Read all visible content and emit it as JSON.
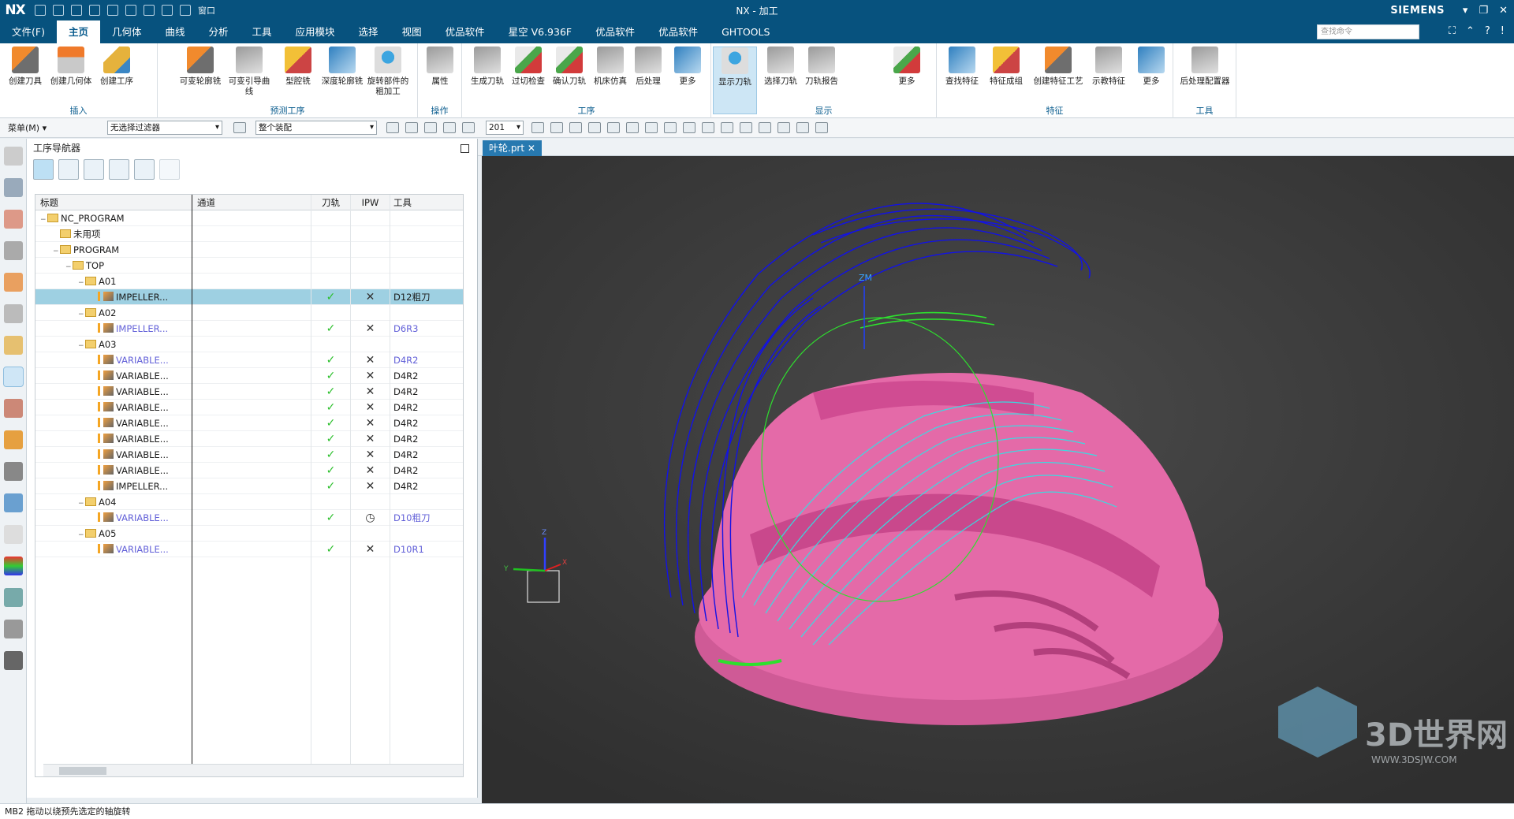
{
  "titlebar": {
    "logo": "NX",
    "window_label": "窗口",
    "title": "NX - 加工",
    "brand": "SIEMENS",
    "buttons": [
      "▾",
      "❐",
      "✕"
    ]
  },
  "menu": {
    "tabs": [
      "文件(F)",
      "主页",
      "几何体",
      "曲线",
      "分析",
      "工具",
      "应用模块",
      "选择",
      "视图",
      "优品软件",
      "星空 V6.936F",
      "优品软件",
      "优品软件",
      "GHTOOLS"
    ],
    "active": "主页",
    "search_placeholder": "查找命令"
  },
  "ribbon": {
    "groups": [
      {
        "label": "插入",
        "buttons": [
          "创建刀具",
          "创建几何体",
          "创建工序"
        ]
      },
      {
        "label": "预测工序",
        "buttons": [
          "可变轮廓铣",
          "可变引导曲线",
          "型腔铣",
          "深度轮廓铣",
          "旋转部件的粗加工"
        ]
      },
      {
        "label": "操作",
        "buttons": [
          "属性"
        ]
      },
      {
        "label": "工序",
        "buttons": [
          "生成刀轨",
          "过切检查",
          "确认刀轨",
          "机床仿真",
          "后处理",
          "更多"
        ]
      },
      {
        "label": "显示",
        "buttons": [
          "显示刀轨",
          "选择刀轨",
          "刀轨报告",
          "更多"
        ]
      },
      {
        "label": "特征",
        "buttons": [
          "查找特征",
          "特征成组",
          "创建特征工艺",
          "示教特征",
          "更多"
        ]
      },
      {
        "label": "工具",
        "buttons": [
          "后处理配置器"
        ]
      }
    ]
  },
  "toolbar2": {
    "menu_label": "菜单(M) ▾",
    "filter": "无选择过滤器",
    "scope": "整个装配",
    "layer": "201"
  },
  "navigator": {
    "title": "工序导航器",
    "columns": [
      "标题",
      "通道",
      "刀轨",
      "IPW",
      "工具"
    ],
    "rows": [
      {
        "indent": 0,
        "type": "root",
        "name": "NC_PROGRAM",
        "path": "",
        "ipw": "",
        "tool": ""
      },
      {
        "indent": 1,
        "type": "folder",
        "name": "未用项",
        "path": "",
        "ipw": "",
        "tool": ""
      },
      {
        "indent": 1,
        "type": "folder",
        "name": "PROGRAM",
        "path": "",
        "ipw": "",
        "tool": ""
      },
      {
        "indent": 2,
        "type": "folder",
        "name": "TOP",
        "path": "",
        "ipw": "",
        "tool": ""
      },
      {
        "indent": 3,
        "type": "folder",
        "name": "A01",
        "path": "",
        "ipw": "",
        "tool": ""
      },
      {
        "indent": 4,
        "type": "op",
        "name": "IMPELLER...",
        "path": "✓",
        "ipw": "✕",
        "tool": "D12粗刀",
        "sel": true
      },
      {
        "indent": 3,
        "type": "folder",
        "name": "A02",
        "path": "",
        "ipw": "",
        "tool": ""
      },
      {
        "indent": 4,
        "type": "op",
        "name": "IMPELLER...",
        "path": "✓",
        "ipw": "✕",
        "tool": "D6R3",
        "link": true
      },
      {
        "indent": 3,
        "type": "folder",
        "name": "A03",
        "path": "",
        "ipw": "",
        "tool": ""
      },
      {
        "indent": 4,
        "type": "op",
        "name": "VARIABLE...",
        "path": "✓",
        "ipw": "✕",
        "tool": "D4R2",
        "link": true
      },
      {
        "indent": 4,
        "type": "op",
        "name": "VARIABLE...",
        "path": "✓",
        "ipw": "✕",
        "tool": "D4R2"
      },
      {
        "indent": 4,
        "type": "op",
        "name": "VARIABLE...",
        "path": "✓",
        "ipw": "✕",
        "tool": "D4R2"
      },
      {
        "indent": 4,
        "type": "op",
        "name": "VARIABLE...",
        "path": "✓",
        "ipw": "✕",
        "tool": "D4R2"
      },
      {
        "indent": 4,
        "type": "op",
        "name": "VARIABLE...",
        "path": "✓",
        "ipw": "✕",
        "tool": "D4R2"
      },
      {
        "indent": 4,
        "type": "op",
        "name": "VARIABLE...",
        "path": "✓",
        "ipw": "✕",
        "tool": "D4R2"
      },
      {
        "indent": 4,
        "type": "op",
        "name": "VARIABLE...",
        "path": "✓",
        "ipw": "✕",
        "tool": "D4R2"
      },
      {
        "indent": 4,
        "type": "op",
        "name": "VARIABLE...",
        "path": "✓",
        "ipw": "✕",
        "tool": "D4R2"
      },
      {
        "indent": 4,
        "type": "op",
        "name": "IMPELLER...",
        "path": "✓",
        "ipw": "✕",
        "tool": "D4R2"
      },
      {
        "indent": 3,
        "type": "folder",
        "name": "A04",
        "path": "",
        "ipw": "",
        "tool": ""
      },
      {
        "indent": 4,
        "type": "op",
        "name": "VARIABLE...",
        "path": "✓",
        "ipw": "◷",
        "tool": "D10粗刀",
        "link": true
      },
      {
        "indent": 3,
        "type": "folder",
        "name": "A05",
        "path": "",
        "ipw": "",
        "tool": ""
      },
      {
        "indent": 4,
        "type": "op",
        "name": "VARIABLE...",
        "path": "✓",
        "ipw": "✕",
        "tool": "D10R1",
        "link": true
      }
    ]
  },
  "viewport": {
    "tab_label": "叶轮.prt",
    "axis_labels": {
      "zm": "ZM",
      "x": "X",
      "y": "Y",
      "z": "Z"
    },
    "watermark": "3D世界网",
    "watermark_url": "WWW.3DSJW.COM"
  },
  "status": {
    "text": "MB2 拖动以绕预先选定的轴旋转"
  },
  "colors": {
    "titlebar": "#07527e",
    "part": "#e46aa8",
    "toolpath_blue": "#1010e0",
    "toolpath_cyan": "#28e8e8",
    "toolpath_green": "#2ee02e",
    "background": "#3b3b3b"
  }
}
